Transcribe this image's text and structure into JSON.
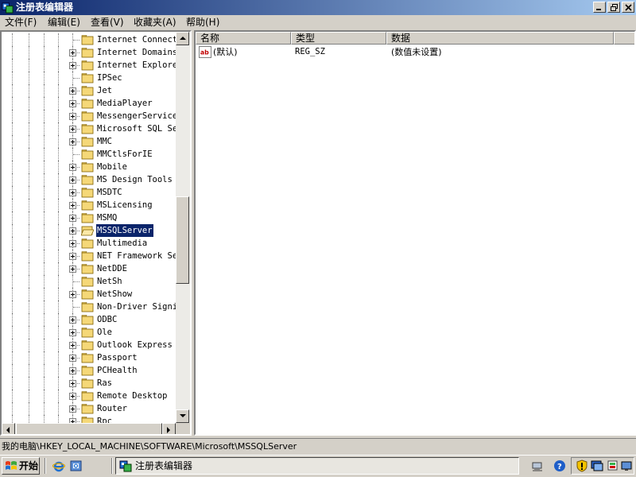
{
  "window": {
    "title": "注册表编辑器",
    "icon": "regedit-icon"
  },
  "menu": [
    {
      "label": "文件(F)"
    },
    {
      "label": "编辑(E)"
    },
    {
      "label": "查看(V)"
    },
    {
      "label": "收藏夹(A)"
    },
    {
      "label": "帮助(H)"
    }
  ],
  "tree": {
    "items": [
      {
        "label": "Internet Connecti",
        "expandable": false
      },
      {
        "label": "Internet Domains",
        "expandable": true
      },
      {
        "label": "Internet Explorer",
        "expandable": true
      },
      {
        "label": "IPSec",
        "expandable": false
      },
      {
        "label": "Jet",
        "expandable": true
      },
      {
        "label": "MediaPlayer",
        "expandable": true
      },
      {
        "label": "MessengerService",
        "expandable": true
      },
      {
        "label": "Microsoft SQL Ser",
        "expandable": true
      },
      {
        "label": "MMC",
        "expandable": true
      },
      {
        "label": "MMCtlsForIE",
        "expandable": false
      },
      {
        "label": "Mobile",
        "expandable": true
      },
      {
        "label": "MS Design Tools",
        "expandable": true
      },
      {
        "label": "MSDTC",
        "expandable": true
      },
      {
        "label": "MSLicensing",
        "expandable": true
      },
      {
        "label": "MSMQ",
        "expandable": true
      },
      {
        "label": "MSSQLServer",
        "expandable": true,
        "selected": true
      },
      {
        "label": "Multimedia",
        "expandable": true
      },
      {
        "label": "NET Framework Set",
        "expandable": true
      },
      {
        "label": "NetDDE",
        "expandable": true
      },
      {
        "label": "NetSh",
        "expandable": false
      },
      {
        "label": "NetShow",
        "expandable": true
      },
      {
        "label": "Non-Driver Signin",
        "expandable": false
      },
      {
        "label": "ODBC",
        "expandable": true
      },
      {
        "label": "Ole",
        "expandable": true
      },
      {
        "label": "Outlook Express",
        "expandable": true
      },
      {
        "label": "Passport",
        "expandable": true
      },
      {
        "label": "PCHealth",
        "expandable": true
      },
      {
        "label": "Ras",
        "expandable": true
      },
      {
        "label": "Remote Desktop",
        "expandable": true
      },
      {
        "label": "Router",
        "expandable": true
      },
      {
        "label": "Rpc",
        "expandable": true
      }
    ]
  },
  "list": {
    "columns": [
      {
        "label": "名称"
      },
      {
        "label": "类型"
      },
      {
        "label": "数据"
      }
    ],
    "rows": [
      {
        "name": "(默认)",
        "type": "REG_SZ",
        "data": "(数值未设置)",
        "icon": "string-value-icon"
      }
    ]
  },
  "statusbar": {
    "path": "我的电脑\\HKEY_LOCAL_MACHINE\\SOFTWARE\\Microsoft\\MSSQLServer"
  },
  "taskbar": {
    "start_label": "开始",
    "task_label": "注册表编辑器",
    "quicklaunch": [
      "ie-icon",
      "outlook-icon"
    ],
    "tray": [
      "network-icon",
      "help-icon",
      "shield-icon",
      "display-icon",
      "security-icon"
    ]
  },
  "colors": {
    "title_start": "#0a246a",
    "title_end": "#a6caf0",
    "selection": "#0a246a",
    "face": "#d4d0c8"
  }
}
